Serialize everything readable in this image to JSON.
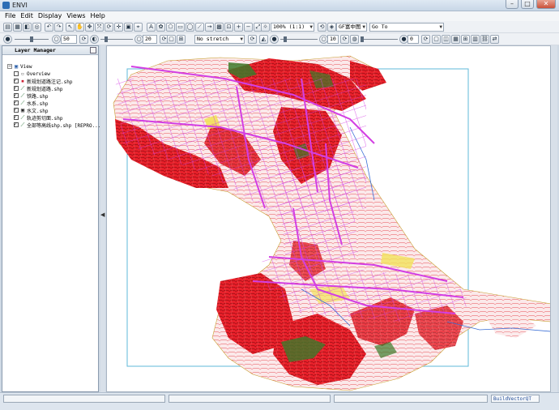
{
  "window": {
    "title": "ENVI",
    "minimize": "–",
    "maximize": "□",
    "close": "✕"
  },
  "menu": [
    "File",
    "Edit",
    "Display",
    "Views",
    "Help"
  ],
  "toolbar": {
    "zoom_combo": "100% (1:1)",
    "layer_combo": "GF富中图",
    "goto_combo": "Go To",
    "stretch_combo": "No stretch",
    "brightness_value": "50",
    "contrast_value": "20",
    "sharpen_value": "10",
    "transparency_value": "0",
    "opacity_value": "0"
  },
  "layer_manager": {
    "title": "Layer Manager",
    "root": "View",
    "overview": "Overview",
    "layers": [
      {
        "name": "新规划道路注记.shp",
        "checked": true
      },
      {
        "name": "新规划道路.shp",
        "checked": true
      },
      {
        "name": "铁路.shp",
        "checked": true
      },
      {
        "name": "水系.shp",
        "checked": true
      },
      {
        "name": "水文.shp",
        "checked": true
      },
      {
        "name": "轨迹剪切面.shp",
        "checked": true
      },
      {
        "name": "全部等高线shp.shp [REPRO...",
        "checked": true
      }
    ]
  },
  "status": {
    "process": "BuildVectorQT"
  },
  "colors": {
    "contour_red": "#e0101a",
    "road_magenta": "#d040e0",
    "frame_cyan": "#5fb8d8",
    "vegetation_green": "#3c7a2a"
  }
}
